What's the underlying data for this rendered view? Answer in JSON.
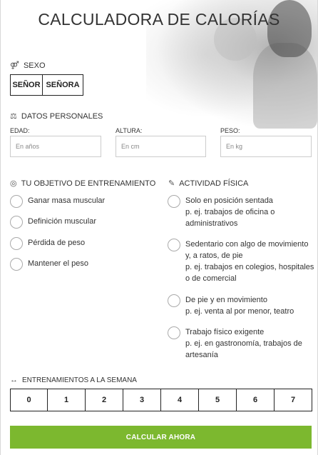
{
  "title": "CALCULADORA DE CALORÍAS",
  "sex": {
    "label": "SEXO",
    "icon": "gender-icon",
    "options": [
      "SEÑOR",
      "SEÑORA"
    ]
  },
  "personal": {
    "label": "DATOS PERSONALES",
    "icon": "scale-icon",
    "fields": [
      {
        "label": "EDAD:",
        "placeholder": "En años"
      },
      {
        "label": "ALTURA:",
        "placeholder": "En cm"
      },
      {
        "label": "PESO:",
        "placeholder": "En kg"
      }
    ]
  },
  "goal": {
    "label": "TU OBJETIVO DE ENTRENAMIENTO",
    "icon": "target-icon",
    "options": [
      "Ganar masa muscular",
      "Definición muscular",
      "Pérdida de peso",
      "Mantener el peso"
    ]
  },
  "activity": {
    "label": "ACTIVIDAD FÍSICA",
    "icon": "activity-icon",
    "options": [
      {
        "lines": [
          "Solo en posición sentada",
          "p. ej. trabajos de oficina o",
          "administrativos"
        ]
      },
      {
        "lines": [
          "Sedentario con algo de movimiento",
          "y, a ratos, de pie",
          "p. ej. trabajos en colegios, hospitales",
          "o de comercial"
        ]
      },
      {
        "lines": [
          "De pie y en movimiento",
          "p. ej. venta al por menor, teatro"
        ]
      },
      {
        "lines": [
          "Trabajo físico exigente",
          "p. ej. en gastronomía, trabajos de",
          "artesanía"
        ]
      }
    ]
  },
  "week": {
    "label": "ENTRENAMIENTOS A LA SEMANA",
    "icon": "arrows-icon",
    "options": [
      "0",
      "1",
      "2",
      "3",
      "4",
      "5",
      "6",
      "7"
    ]
  },
  "cta": "CALCULAR AHORA",
  "colors": {
    "accent": "#7cb82f",
    "border": "#222222"
  }
}
